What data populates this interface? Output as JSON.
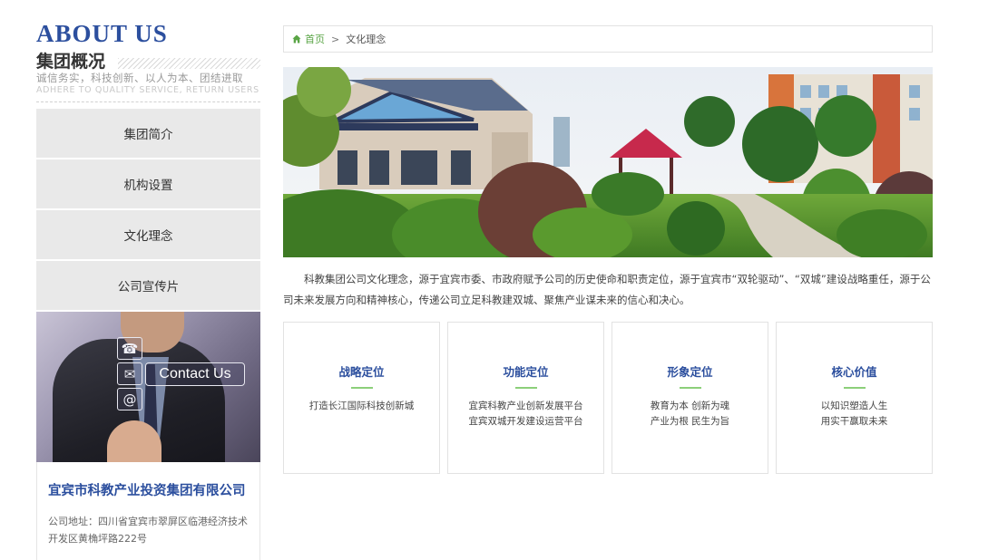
{
  "sidebar": {
    "about_title": "ABOUT US",
    "group_title": "集团概况",
    "slogan_cn": "诚信务实，科技创新、以人为本、团结进取",
    "slogan_en": "ADHERE TO QUALITY SERVICE, RETURN USERS",
    "menu": [
      "集团简介",
      "机构设置",
      "文化理念",
      "公司宣传片"
    ],
    "contact_label": "Contact Us",
    "contact_icons": [
      "phone-icon",
      "mail-icon",
      "at-icon"
    ],
    "company_name": "宜宾市科教产业投资集团有限公司",
    "company_address": "公司地址：四川省宜宾市翠屏区临港经济技术开发区黄桷坪路222号"
  },
  "breadcrumb": {
    "home": "首页",
    "separator": ">",
    "current": "文化理念"
  },
  "intro": "科教集团公司文化理念，源于宜宾市委、市政府赋予公司的历史使命和职责定位，源于宜宾市“双轮驱动”、“双城”建设战略重任，源于公司未来发展方向和精神核心，传递公司立足科教建双城、聚焦产业谋未来的信心和决心。",
  "cards": [
    {
      "title": "战略定位",
      "lines": [
        "打造长江国际科技创新城"
      ]
    },
    {
      "title": "功能定位",
      "lines": [
        "宜宾科教产业创新发展平台",
        "宜宾双城开发建设运营平台"
      ]
    },
    {
      "title": "形象定位",
      "lines": [
        "教育为本 创新为魂",
        "产业为根 民生为旨"
      ]
    },
    {
      "title": "核心价值",
      "lines": [
        "以知识塑造人生",
        "用实干赢取未来"
      ]
    }
  ],
  "colors": {
    "brand_blue": "#2c4f9e",
    "accent_green": "#5aa546",
    "menu_bg": "#e9e9e9"
  }
}
